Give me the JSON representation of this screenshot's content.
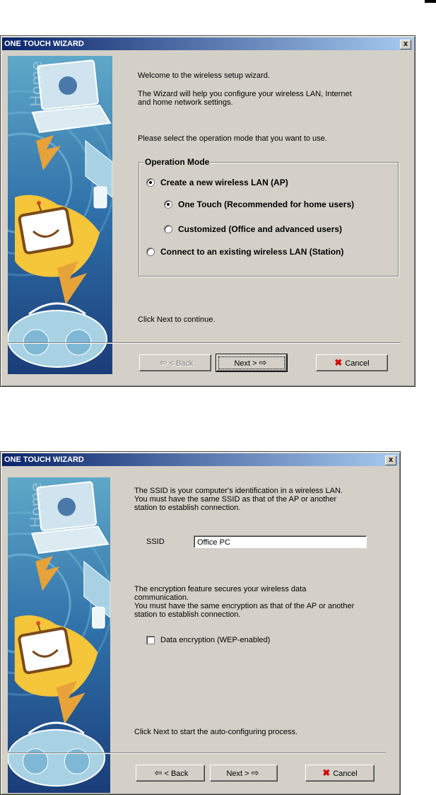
{
  "wizard1": {
    "title": "ONE TOUCH WIZARD",
    "close_label": "x",
    "welcome": "Welcome to the wireless setup wizard.",
    "help_line1": "The Wizard will help you configure your wireless LAN, Internet",
    "help_line2": "and home network settings.",
    "select_prompt": "Please select the operation mode that you want to use.",
    "group_label": "Operation Mode",
    "options": [
      {
        "label": "Create a new wireless LAN (AP)",
        "selected": true
      },
      {
        "label": "One Touch (Recommended for home users)",
        "selected": true
      },
      {
        "label": "Customized (Office and advanced users)",
        "selected": false
      },
      {
        "label": "Connect to an existing wireless LAN (Station)",
        "selected": false
      }
    ],
    "footer_note": "Click Next to continue.",
    "back_label": "< Back",
    "next_label": "Next >",
    "cancel_label": "Cancel"
  },
  "wizard2": {
    "title": "ONE TOUCH WIZARD",
    "close_label": "x",
    "ssid_intro_1": "The SSID is your computer's identification in a wireless LAN.",
    "ssid_intro_2": "You must have the same SSID as that of the AP or another",
    "ssid_intro_3": "station to establish connection.",
    "ssid_label": "SSID",
    "ssid_value": "Office PC",
    "enc_line1": "The encryption feature secures your wireless data",
    "enc_line2": "communication.",
    "enc_line3": "You must have the same encryption as that of the AP or another",
    "enc_line4": "station to establish connection.",
    "encryption_label": "Data encryption (WEP-enabled)",
    "encryption_checked": false,
    "footer_note": "Click Next to start the auto-configuring process.",
    "back_label": "< Back",
    "next_label": "Next >",
    "cancel_label": "Cancel"
  },
  "side_art": {
    "watermark": "Home"
  },
  "icons": {
    "back": "left-arrow-icon",
    "next": "right-arrow-icon",
    "cancel": "red-x-icon"
  }
}
